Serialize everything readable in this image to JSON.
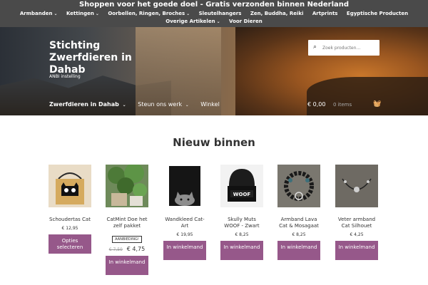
{
  "topbar": {
    "promo": "Shoppen voor het goede doel - Gratis verzonden binnen Nederland",
    "menu_row1": [
      "Armbanden",
      "Kettingen",
      "Oorbellen, Ringen, Broches",
      "Sleutelhangers",
      "Zen, Buddha, Reiki",
      "Artprints",
      "Egyptische Producten"
    ],
    "menu_row2": [
      "Overige Artikelen",
      "Voor Dieren"
    ]
  },
  "hero": {
    "title": "Stichting Zwerfdieren in Dahab",
    "tagline": "ANBI instelling",
    "search_placeholder": "Zoek producten…",
    "nav": [
      "Zwerfdieren in Dahab",
      "Steun ons werk",
      "Winkel"
    ],
    "cart_total": "€ 0,00",
    "cart_count": "0 items"
  },
  "section": {
    "title": "Nieuw binnen"
  },
  "products": [
    {
      "name": "Schoudertas Cat",
      "price": "€ 12,95",
      "button": "Opties selecteren",
      "image": "cat-tote-bag-image"
    },
    {
      "name": "CatMint Doe het zelf pakket",
      "badge": "AANBIEDING!",
      "old_price": "€ 7,50",
      "price": "€ 4,75",
      "button": "In winkelmand",
      "image": "catmint-plant-image"
    },
    {
      "name": "Wandkleed Cat-Art",
      "price": "€ 19,95",
      "button": "In winkelmand",
      "image": "cat-tapestry-image"
    },
    {
      "name": "Skully Muts WOOF - Zwart",
      "price": "€ 8,25",
      "button": "In winkelmand",
      "image": "woof-beanie-image"
    },
    {
      "name": "Armband Lava Cat & Mosagaat",
      "price": "€ 8,25",
      "button": "In winkelmand",
      "image": "lava-bracelet-image"
    },
    {
      "name": "Veter armband Cat Silhouet",
      "price": "€ 4,25",
      "button": "In winkelmand",
      "image": "cord-bracelet-image"
    }
  ],
  "colors": {
    "topbar": "#4a4a4a",
    "button": "#96588a",
    "heading": "#333333"
  }
}
